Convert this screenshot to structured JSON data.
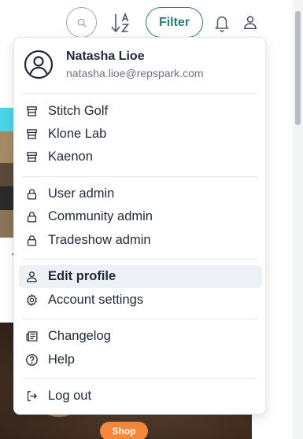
{
  "toolbar": {
    "filter_label": "Filter",
    "sort_icon": "sort-alpha-icon",
    "search_icon": "search-icon",
    "bell_icon": "bell-icon",
    "user_icon": "user-icon"
  },
  "user": {
    "name": "Natasha Lioe",
    "email": "natasha.lioe@repspark.com"
  },
  "menu": {
    "companies": [
      {
        "label": "Stitch Golf",
        "icon": "store-icon"
      },
      {
        "label": "Klone Lab",
        "icon": "store-icon"
      },
      {
        "label": "Kaenon",
        "icon": "store-icon"
      }
    ],
    "admin": [
      {
        "label": "User admin",
        "icon": "lock-icon"
      },
      {
        "label": "Community admin",
        "icon": "lock-icon"
      },
      {
        "label": "Tradeshow admin",
        "icon": "lock-icon"
      }
    ],
    "account": [
      {
        "label": "Edit profile",
        "icon": "user-icon",
        "active": true
      },
      {
        "label": "Account settings",
        "icon": "gear-icon"
      }
    ],
    "info": [
      {
        "label": "Changelog",
        "icon": "newspaper-icon"
      },
      {
        "label": "Help",
        "icon": "help-circle-icon"
      }
    ],
    "logout": {
      "label": "Log out",
      "icon": "logout-icon"
    }
  },
  "background": {
    "shop_label": "Shop"
  },
  "colors": {
    "accent": "#2c7a7b",
    "shop_button": "#f4883a",
    "active_item_bg": "#edf1f5"
  }
}
